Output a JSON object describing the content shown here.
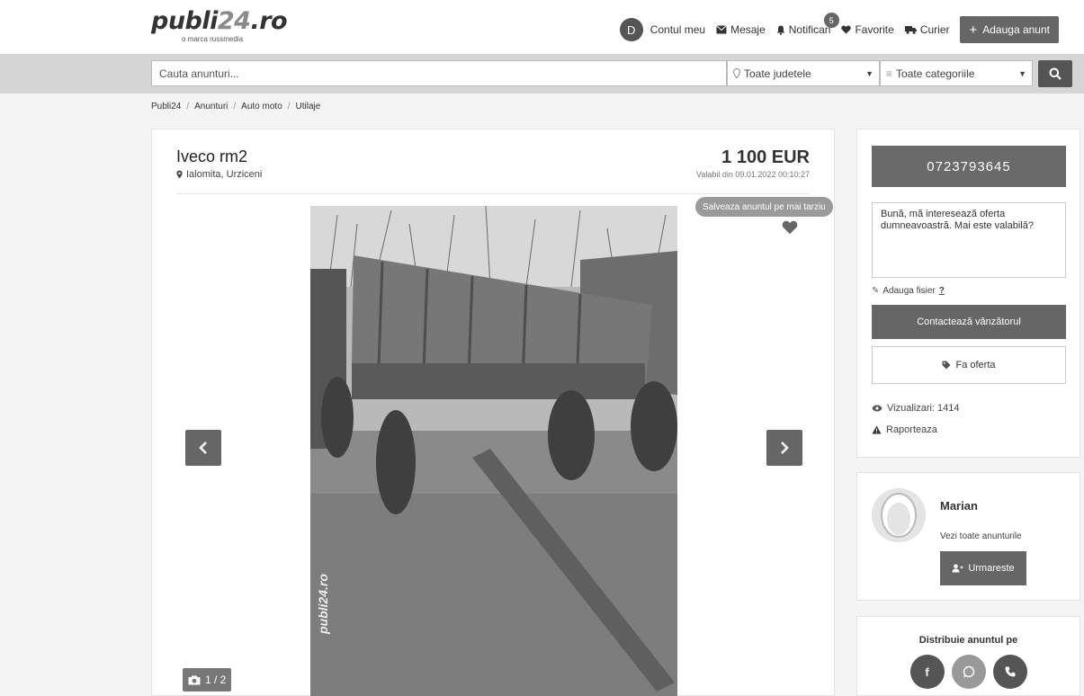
{
  "header": {
    "logo_main": "publi",
    "logo_num": "24",
    "logo_tld": ".ro",
    "tagline": "o marca russmedia",
    "avatar_letter": "D",
    "account_label": "Contul meu",
    "messages_label": "Mesaje",
    "notifications_label": "Notificari",
    "notifications_count": "5",
    "favorites_label": "Favorite",
    "courier_label": "Curier",
    "add_ad_label": "Adauga anunt"
  },
  "search": {
    "placeholder": "Cauta anunturi...",
    "county_value": "Toate judetele",
    "category_value": "Toate categoriile"
  },
  "breadcrumb": [
    "Publi24",
    "Anunturi",
    "Auto moto",
    "Utilaje"
  ],
  "listing": {
    "title": "Iveco rm2",
    "location": "Ialomita, Urziceni",
    "price": "1 100 EUR",
    "valid_from": "Valabil din 09.01.2022 00:10:27",
    "save_tooltip": "Salveaza anuntul pe mai tarziu",
    "photo_counter": "1 / 2",
    "photo_watermark": "publi24.ro"
  },
  "contact": {
    "phone": "0723793645",
    "message": "Bună, mă interesează oferta dumneavoastră. Mai este valabilă?",
    "attach_label": "Adauga fisier",
    "attach_help": "?",
    "contact_button": "Contactează vânzătorul",
    "offer_button": "Fa oferta",
    "views": "Vizualizari: 1414",
    "report": "Raporteaza"
  },
  "seller": {
    "name": "Marian",
    "see_all": "Vezi toate anunturile",
    "follow": "Urmareste"
  },
  "share": {
    "title": "Distribuie anuntul pe",
    "facebook_letter": "f"
  },
  "colors": {
    "button_gray": "#666666",
    "page_bg": "#f4f4f4",
    "search_strip": "#d6d6d6"
  }
}
